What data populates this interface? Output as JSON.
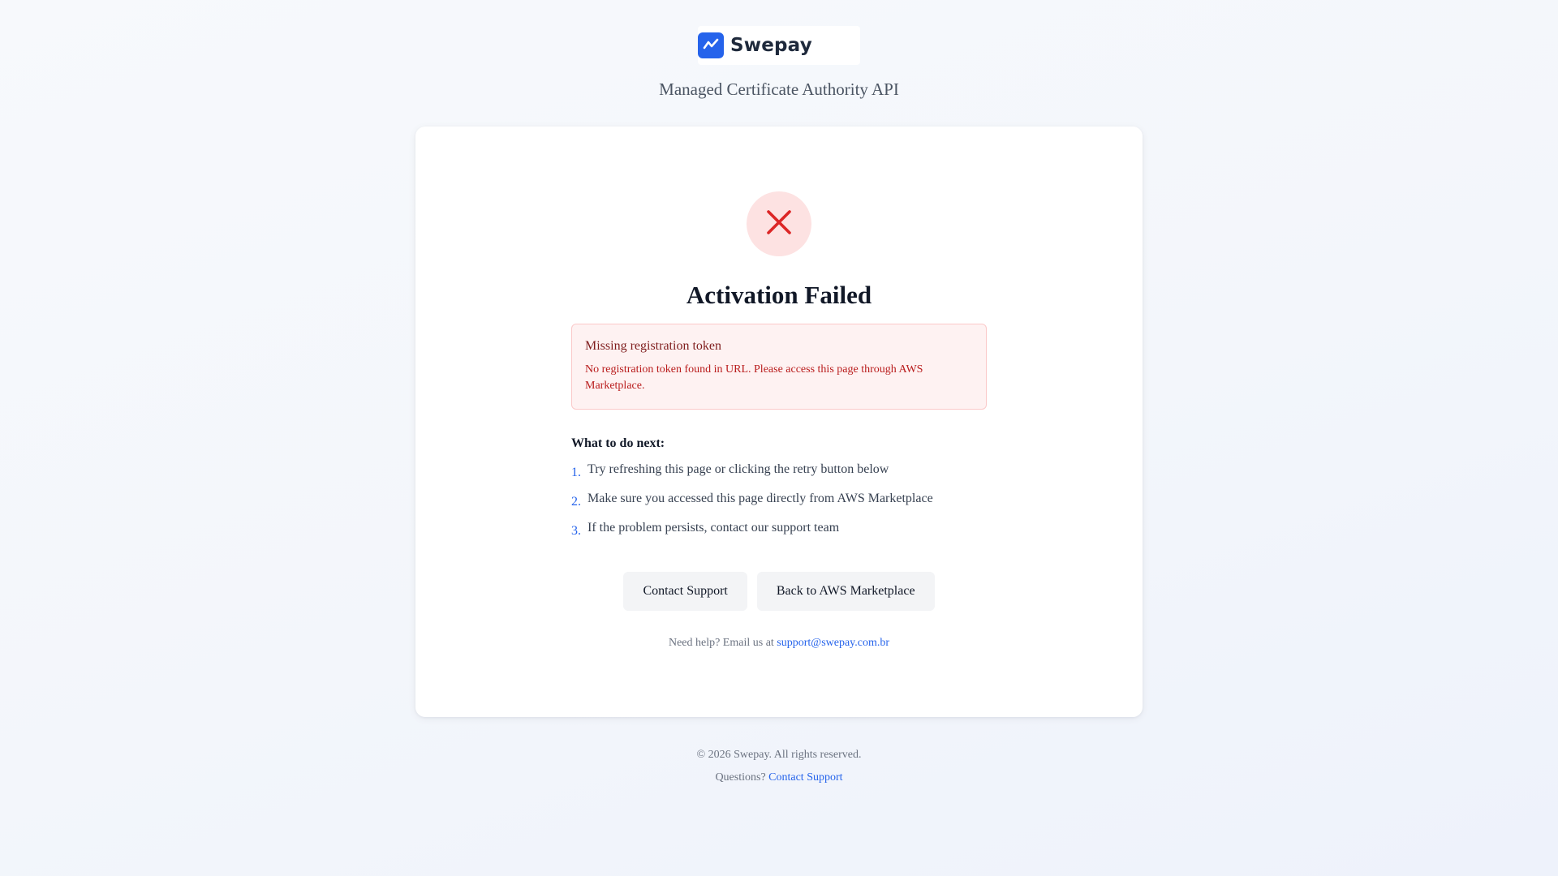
{
  "brand": {
    "name": "Swepay",
    "logo_icon": "trend-line-icon",
    "accent_color": "#2563eb",
    "subtitle": "Managed Certificate Authority API"
  },
  "status": {
    "icon": "close-icon",
    "title": "Activation Failed"
  },
  "alert": {
    "title": "Missing registration token",
    "message": "No registration token found in URL. Please access this page through AWS Marketplace."
  },
  "next_steps": {
    "heading": "What to do next:",
    "items": [
      {
        "num": "1.",
        "text": "Try refreshing this page or clicking the retry button below"
      },
      {
        "num": "2.",
        "text": "Make sure you accessed this page directly from AWS Marketplace"
      },
      {
        "num": "3.",
        "text": "If the problem persists, contact our support team"
      }
    ]
  },
  "actions": {
    "contact_support": "Contact Support",
    "back_marketplace": "Back to AWS Marketplace"
  },
  "help": {
    "prefix": "Need help? Email us at",
    "email": "support@swepay.com.br"
  },
  "footer": {
    "copyright": "© 2026 Swepay. All rights reserved.",
    "questions_prefix": "Questions?",
    "questions_link": "Contact Support"
  }
}
